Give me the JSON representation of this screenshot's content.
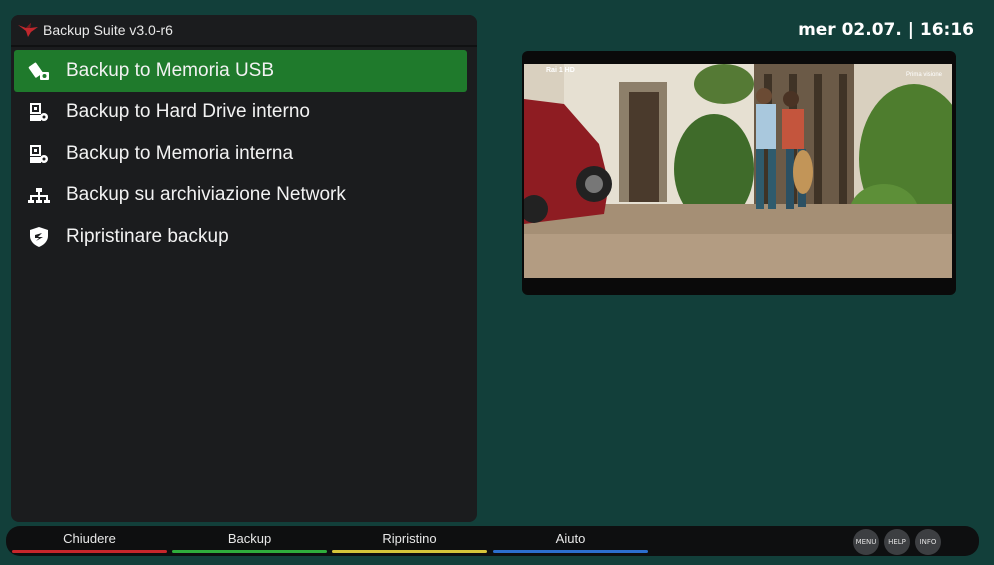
{
  "app": {
    "title": "Backup Suite v3.0-r6"
  },
  "clock": "mer 02.07. | 16:16",
  "menu": {
    "items": [
      {
        "label": "Backup to Memoria USB",
        "icon": "usb-drive-icon",
        "selected": true
      },
      {
        "label": "Backup to Hard Drive interno",
        "icon": "hard-drive-icon",
        "selected": false
      },
      {
        "label": "Backup to Memoria interna",
        "icon": "internal-memory-icon",
        "selected": false
      },
      {
        "label": "Backup su archiviazione Network",
        "icon": "network-icon",
        "selected": false
      },
      {
        "label": "Ripristinare backup",
        "icon": "shield-restore-icon",
        "selected": false
      }
    ]
  },
  "preview": {
    "watermark_left": "Rai 1 HD",
    "watermark_right": "Prima visione"
  },
  "footer": {
    "keys": [
      {
        "label": "Chiudere",
        "color": "#c8262b"
      },
      {
        "label": "Backup",
        "color": "#2fae3c"
      },
      {
        "label": "Ripristino",
        "color": "#d6c53a"
      },
      {
        "label": "Aiuto",
        "color": "#2c6fcf"
      }
    ],
    "buttons": [
      "MENU",
      "HELP",
      "INFO"
    ]
  },
  "colors": {
    "background": "#123f3a",
    "panel": "#1b1c1e",
    "selected": "#1f7a2c"
  }
}
